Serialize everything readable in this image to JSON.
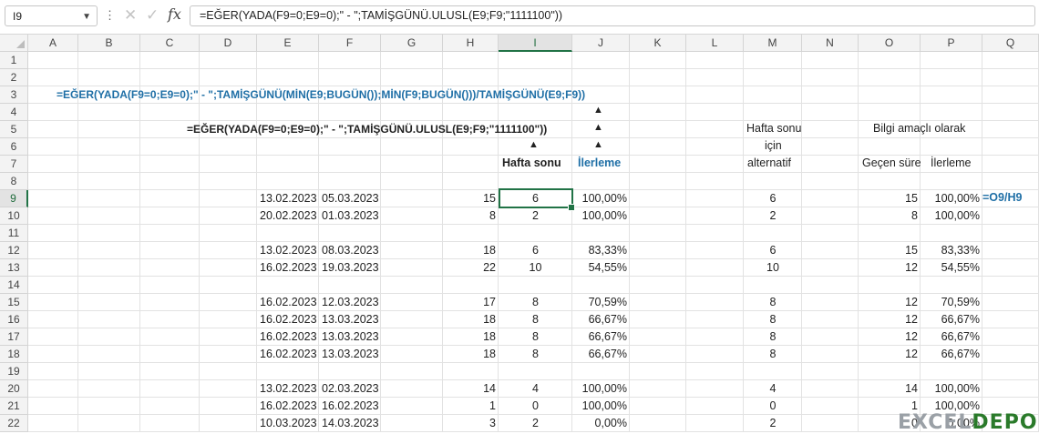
{
  "name_box": "I9",
  "formula_bar": "=EĞER(YADA(F9=0;E9=0);\" - \";TAMİŞGÜNÜ.ULUSL(E9;F9;\"1111100\"))",
  "columns": [
    "A",
    "B",
    "C",
    "D",
    "E",
    "F",
    "G",
    "H",
    "I",
    "J",
    "K",
    "L",
    "M",
    "N",
    "O",
    "P",
    "Q"
  ],
  "selected_column": "I",
  "selected_row": "9",
  "rows": [
    "1",
    "2",
    "3",
    "4",
    "5",
    "6",
    "7",
    "8",
    "9",
    "10",
    "11",
    "12",
    "13",
    "14",
    "15",
    "16",
    "17",
    "18",
    "19",
    "20",
    "21",
    "22"
  ],
  "notes": {
    "row3_formula": "=EĞER(YADA(F9=0;E9=0);\" - \";TAMİŞGÜNÜ(MİN(E9;BUGÜN());MİN(F9;BUGÜN()))/TAMİŞGÜNÜ(E9;F9))",
    "row5_formula": "=EĞER(YADA(F9=0;E9=0);\" - \";TAMİŞGÜNÜ.ULUSL(E9;F9;\"1111100\"))",
    "arrow": "▲",
    "hafta_sonu_header": "Hafta sonu",
    "ilerleme_header": "İlerleme",
    "m5": "Hafta sonu",
    "m6": "için",
    "m7": "alternatif",
    "o5": "Bilgi amaçlı olarak",
    "o7": "Geçen süre",
    "p7": "İlerleme",
    "q9": "=O9/H9"
  },
  "table": [
    {
      "row": "9",
      "e": "13.02.2023",
      "f": "05.03.2023",
      "h": "15",
      "i": "6",
      "j": "100,00%",
      "m": "6",
      "o": "15",
      "p": "100,00%"
    },
    {
      "row": "10",
      "e": "20.02.2023",
      "f": "01.03.2023",
      "h": "8",
      "i": "2",
      "j": "100,00%",
      "m": "2",
      "o": "8",
      "p": "100,00%"
    },
    {
      "row": "12",
      "e": "13.02.2023",
      "f": "08.03.2023",
      "h": "18",
      "i": "6",
      "j": "83,33%",
      "m": "6",
      "o": "15",
      "p": "83,33%"
    },
    {
      "row": "13",
      "e": "16.02.2023",
      "f": "19.03.2023",
      "h": "22",
      "i": "10",
      "j": "54,55%",
      "m": "10",
      "o": "12",
      "p": "54,55%"
    },
    {
      "row": "15",
      "e": "16.02.2023",
      "f": "12.03.2023",
      "h": "17",
      "i": "8",
      "j": "70,59%",
      "m": "8",
      "o": "12",
      "p": "70,59%"
    },
    {
      "row": "16",
      "e": "16.02.2023",
      "f": "13.03.2023",
      "h": "18",
      "i": "8",
      "j": "66,67%",
      "m": "8",
      "o": "12",
      "p": "66,67%"
    },
    {
      "row": "17",
      "e": "16.02.2023",
      "f": "13.03.2023",
      "h": "18",
      "i": "8",
      "j": "66,67%",
      "m": "8",
      "o": "12",
      "p": "66,67%"
    },
    {
      "row": "18",
      "e": "16.02.2023",
      "f": "13.03.2023",
      "h": "18",
      "i": "8",
      "j": "66,67%",
      "m": "8",
      "o": "12",
      "p": "66,67%"
    },
    {
      "row": "20",
      "e": "13.02.2023",
      "f": "02.03.2023",
      "h": "14",
      "i": "4",
      "j": "100,00%",
      "m": "4",
      "o": "14",
      "p": "100,00%"
    },
    {
      "row": "21",
      "e": "16.02.2023",
      "f": "16.02.2023",
      "h": "1",
      "i": "0",
      "j": "100,00%",
      "m": "0",
      "o": "1",
      "p": "100,00%"
    },
    {
      "row": "22",
      "e": "10.03.2023",
      "f": "14.03.2023",
      "h": "3",
      "i": "2",
      "j": "0,00%",
      "m": "2",
      "o": "0",
      "p": "0,00%"
    }
  ],
  "logo_text_left": "EXCEL",
  "logo_text_right": "DEPO"
}
